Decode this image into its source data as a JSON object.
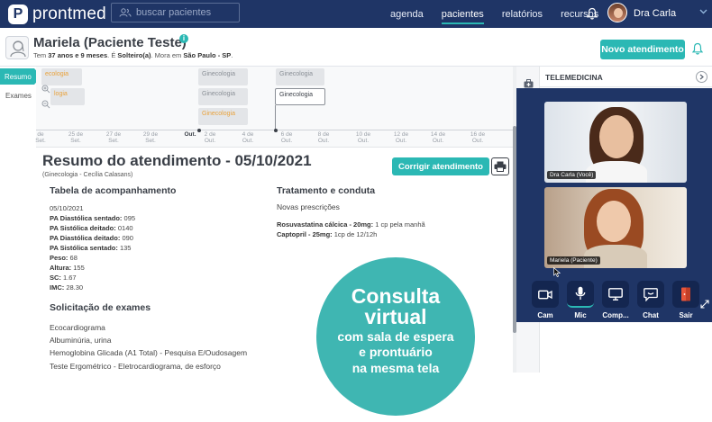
{
  "app": {
    "brand_letter": "P",
    "brand_name": "prontmed",
    "search_placeholder": "buscar pacientes",
    "nav": [
      "agenda",
      "pacientes",
      "relatórios",
      "recursos"
    ],
    "active_nav": "pacientes",
    "user_name": "Dra Carla"
  },
  "patient": {
    "name": "Mariela (Paciente Teste)",
    "details_prefix": "Tem ",
    "age": "37 anos e 9 meses",
    "details_mid": ". É ",
    "marital": "Solteiro(a)",
    "details_mid2": ". Mora em ",
    "city": "São Paulo - SP",
    "details_end": ".",
    "new_button": "Novo atendimento"
  },
  "left_tabs": {
    "resumo": "Resumo",
    "exames": "Exames"
  },
  "timeline": {
    "cards": [
      {
        "label": "ecologia",
        "style": "orange"
      },
      {
        "label": "logia",
        "style": "orange"
      },
      {
        "label": "Ginecologia",
        "style": "grey"
      },
      {
        "label": "Ginecologia",
        "style": "grey"
      },
      {
        "label": "Ginecologia",
        "style": "orange"
      },
      {
        "label": "Ginecologia",
        "style": "grey"
      },
      {
        "label": "Ginecologia",
        "style": "selected"
      }
    ],
    "ticks": [
      {
        "day": "de",
        "month": "Set."
      },
      {
        "day": "25 de",
        "month": "Set."
      },
      {
        "day": "27 de",
        "month": "Set."
      },
      {
        "day": "29 de",
        "month": "Set."
      },
      {
        "day": "",
        "month": "Out."
      },
      {
        "day": "2 de",
        "month": "Out."
      },
      {
        "day": "4 de",
        "month": "Out."
      },
      {
        "day": "6 de",
        "month": "Out."
      },
      {
        "day": "8 de",
        "month": "Out."
      },
      {
        "day": "10 de",
        "month": "Out."
      },
      {
        "day": "12 de",
        "month": "Out."
      },
      {
        "day": "14 de",
        "month": "Out."
      },
      {
        "day": "16 de",
        "month": "Out."
      }
    ]
  },
  "summary": {
    "title": "Resumo do atendimento - 05/10/2021",
    "subtitle": "(Ginecologia - Cecília Calasans)",
    "correct_button": "Corrigir atendimento",
    "followup_title": "Tabela de acompanhamento",
    "date": "05/10/2021",
    "vitals": [
      {
        "label": "PA Diastólica sentado:",
        "value": " 095"
      },
      {
        "label": "PA Sistólica deitado:",
        "value": " 0140"
      },
      {
        "label": "PA Diastólica deitado:",
        "value": " 090"
      },
      {
        "label": "PA Sistólica sentado:",
        "value": " 135"
      },
      {
        "label": "Peso:",
        "value": " 68"
      },
      {
        "label": "Altura:",
        "value": " 155"
      },
      {
        "label": "SC:",
        "value": " 1.67"
      },
      {
        "label": "IMC:",
        "value": " 28.30"
      }
    ],
    "treatment_title": "Tratamento e conduta",
    "treatment_sub": "Novas prescrições",
    "meds": [
      {
        "name": "Rosuvastatina cálcica - 20mg:",
        "dose": " 1 cp pela manhã"
      },
      {
        "name": "Captopril - 25mg:",
        "dose": " 1cp de 12/12h"
      }
    ],
    "exams_title": "Solicitação de exames",
    "exams": [
      "Ecocardiograma",
      "Albuminúria, urina",
      "Hemoglobina Glicada (A1 Total) - Pesquisa E/Oudosagem",
      "Teste Ergométrico - Eletrocardiograma, de esforço"
    ]
  },
  "telemedicine": {
    "title": "TELEMEDICINA",
    "doctor_label": "Dra Carla (Você)",
    "patient_label": "Mariela (Paciente)",
    "controls": [
      {
        "label": "Cam",
        "icon": "camera-icon"
      },
      {
        "label": "Mic",
        "icon": "microphone-icon"
      },
      {
        "label": "Comp...",
        "icon": "screen-share-icon"
      },
      {
        "label": "Chat",
        "icon": "chat-icon"
      },
      {
        "label": "Sair",
        "icon": "exit-door-icon"
      }
    ],
    "exit_color": "#e8553a"
  },
  "promo": {
    "line1a": "Consulta",
    "line1b": "virtual",
    "line2a": "com sala de espera",
    "line2b": "e prontuário",
    "line3": "na mesma tela"
  },
  "colors": {
    "navy": "#1f3566",
    "teal": "#2bb8b4",
    "orange": "#e9a23b"
  }
}
